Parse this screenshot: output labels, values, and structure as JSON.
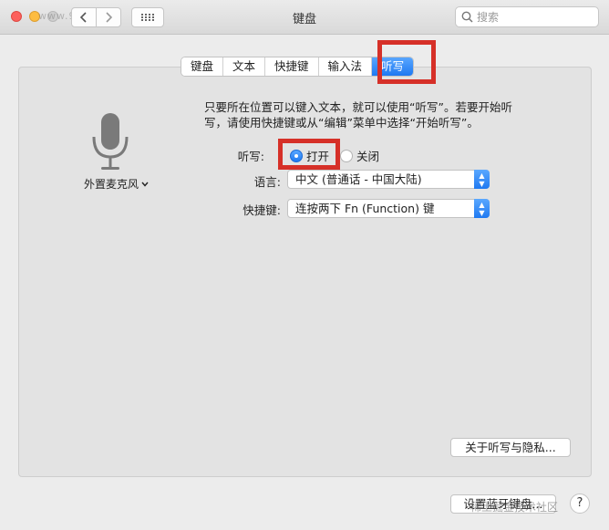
{
  "window": {
    "title": "键盘",
    "search_placeholder": "搜索",
    "watermark_top": "www.9969.net"
  },
  "tabs": [
    {
      "label": "键盘",
      "active": false
    },
    {
      "label": "文本",
      "active": false
    },
    {
      "label": "快捷键",
      "active": false
    },
    {
      "label": "输入法",
      "active": false
    },
    {
      "label": "听写",
      "active": true
    }
  ],
  "mic": {
    "label": "外置麦克风",
    "icon": "microphone-icon"
  },
  "description": "只要所在位置可以键入文本，就可以使用“听写”。若要开始听写，请使用快捷键或从“编辑”菜单中选择“开始听写”。",
  "dictation": {
    "label": "听写:",
    "on_label": "打开",
    "off_label": "关闭",
    "selected": "打开"
  },
  "language": {
    "label": "语言:",
    "value": "中文 (普通话 - 中国大陆)"
  },
  "shortcut": {
    "label": "快捷键:",
    "value": "连按两下 Fn (Function) 键"
  },
  "buttons": {
    "privacy": "关于听写与隐私...",
    "bluetooth": "设置蓝牙键盘...",
    "help": "?"
  },
  "watermark_bottom": "稀土掘金技术社区",
  "colors": {
    "accent": "#1f79f1",
    "highlight": "#d63028"
  }
}
